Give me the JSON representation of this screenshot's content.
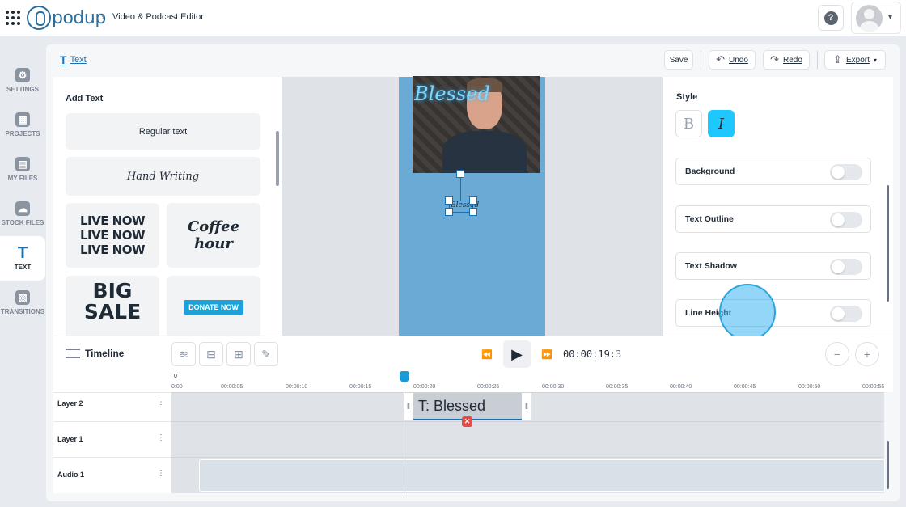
{
  "app": {
    "logo_text": "podup",
    "breadcrumb_sep": "›",
    "breadcrumb": "Video & Podcast Editor",
    "help_icon": "?",
    "user_caret": "▾"
  },
  "sidebar": {
    "items": [
      {
        "label": "SETTINGS",
        "icon": "gear-icon",
        "glyph": "⚙"
      },
      {
        "label": "PROJECTS",
        "icon": "projects-icon",
        "glyph": "▦"
      },
      {
        "label": "MY FILES",
        "icon": "folder-icon",
        "glyph": "▤"
      },
      {
        "label": "STOCK FILES",
        "icon": "cloud-icon",
        "glyph": "☁"
      },
      {
        "label": "TEXT",
        "icon": "text-icon",
        "glyph": "T"
      },
      {
        "label": "TRANSITIONS",
        "icon": "transitions-icon",
        "glyph": "▧"
      }
    ]
  },
  "toolbar": {
    "tab_icon": "T",
    "tab_label": "Text",
    "save": "Save",
    "undo": "Undo",
    "redo": "Redo",
    "export": "Export",
    "undo_icon": "↶",
    "redo_icon": "↷",
    "export_icon": "⇪",
    "export_caret": "▾"
  },
  "add_text": {
    "title": "Add Text",
    "presets": [
      {
        "label": "Regular text"
      },
      {
        "label": "Hand Writing"
      },
      {
        "label": "LIVE NOW\nLIVE NOW\nLIVE NOW"
      },
      {
        "label": "Coffee hour"
      },
      {
        "label": "BIG SALE"
      },
      {
        "label": "DONATE NOW"
      }
    ]
  },
  "canvas": {
    "video_overlay_text": "Blessed",
    "selected_text": "Blessed"
  },
  "style_panel": {
    "title": "Style",
    "bold_label": "B",
    "italic_label": "I",
    "options": [
      {
        "label": "Background",
        "enabled": false
      },
      {
        "label": "Text Outline",
        "enabled": false
      },
      {
        "label": "Text Shadow",
        "enabled": false
      },
      {
        "label": "Line Height",
        "enabled": false
      }
    ]
  },
  "timeline": {
    "title": "Timeline",
    "timecode_main": "00:00:19:",
    "timecode_frame": "3",
    "rewind_icon": "⏪",
    "play_icon": "▶",
    "forward_icon": "⏩",
    "zoom_out_icon": "−",
    "zoom_in_icon": "+",
    "tool_icons": [
      "≋",
      "⊟",
      "⊞",
      "✎"
    ],
    "zero_label": "0",
    "ticks": [
      "0:00",
      "00:00:05",
      "00:00:10",
      "00:00:15",
      "00:00:20",
      "00:00:25",
      "00:00:30",
      "00:00:35",
      "00:00:40",
      "00:00:45",
      "00:00:50",
      "00:00:55"
    ],
    "layers": [
      {
        "name": "Layer 2"
      },
      {
        "name": "Layer 1"
      },
      {
        "name": "Audio 1"
      }
    ],
    "kebab": "⋮",
    "clip_text": "T: Blessed",
    "clip_grip": "‖",
    "clip_delete": "✕"
  },
  "colors": {
    "accent": "#1a6fb0",
    "italic_active": "#1ec8ff",
    "phone_bg": "#6caad6",
    "playhead": "#1a9bd7"
  }
}
